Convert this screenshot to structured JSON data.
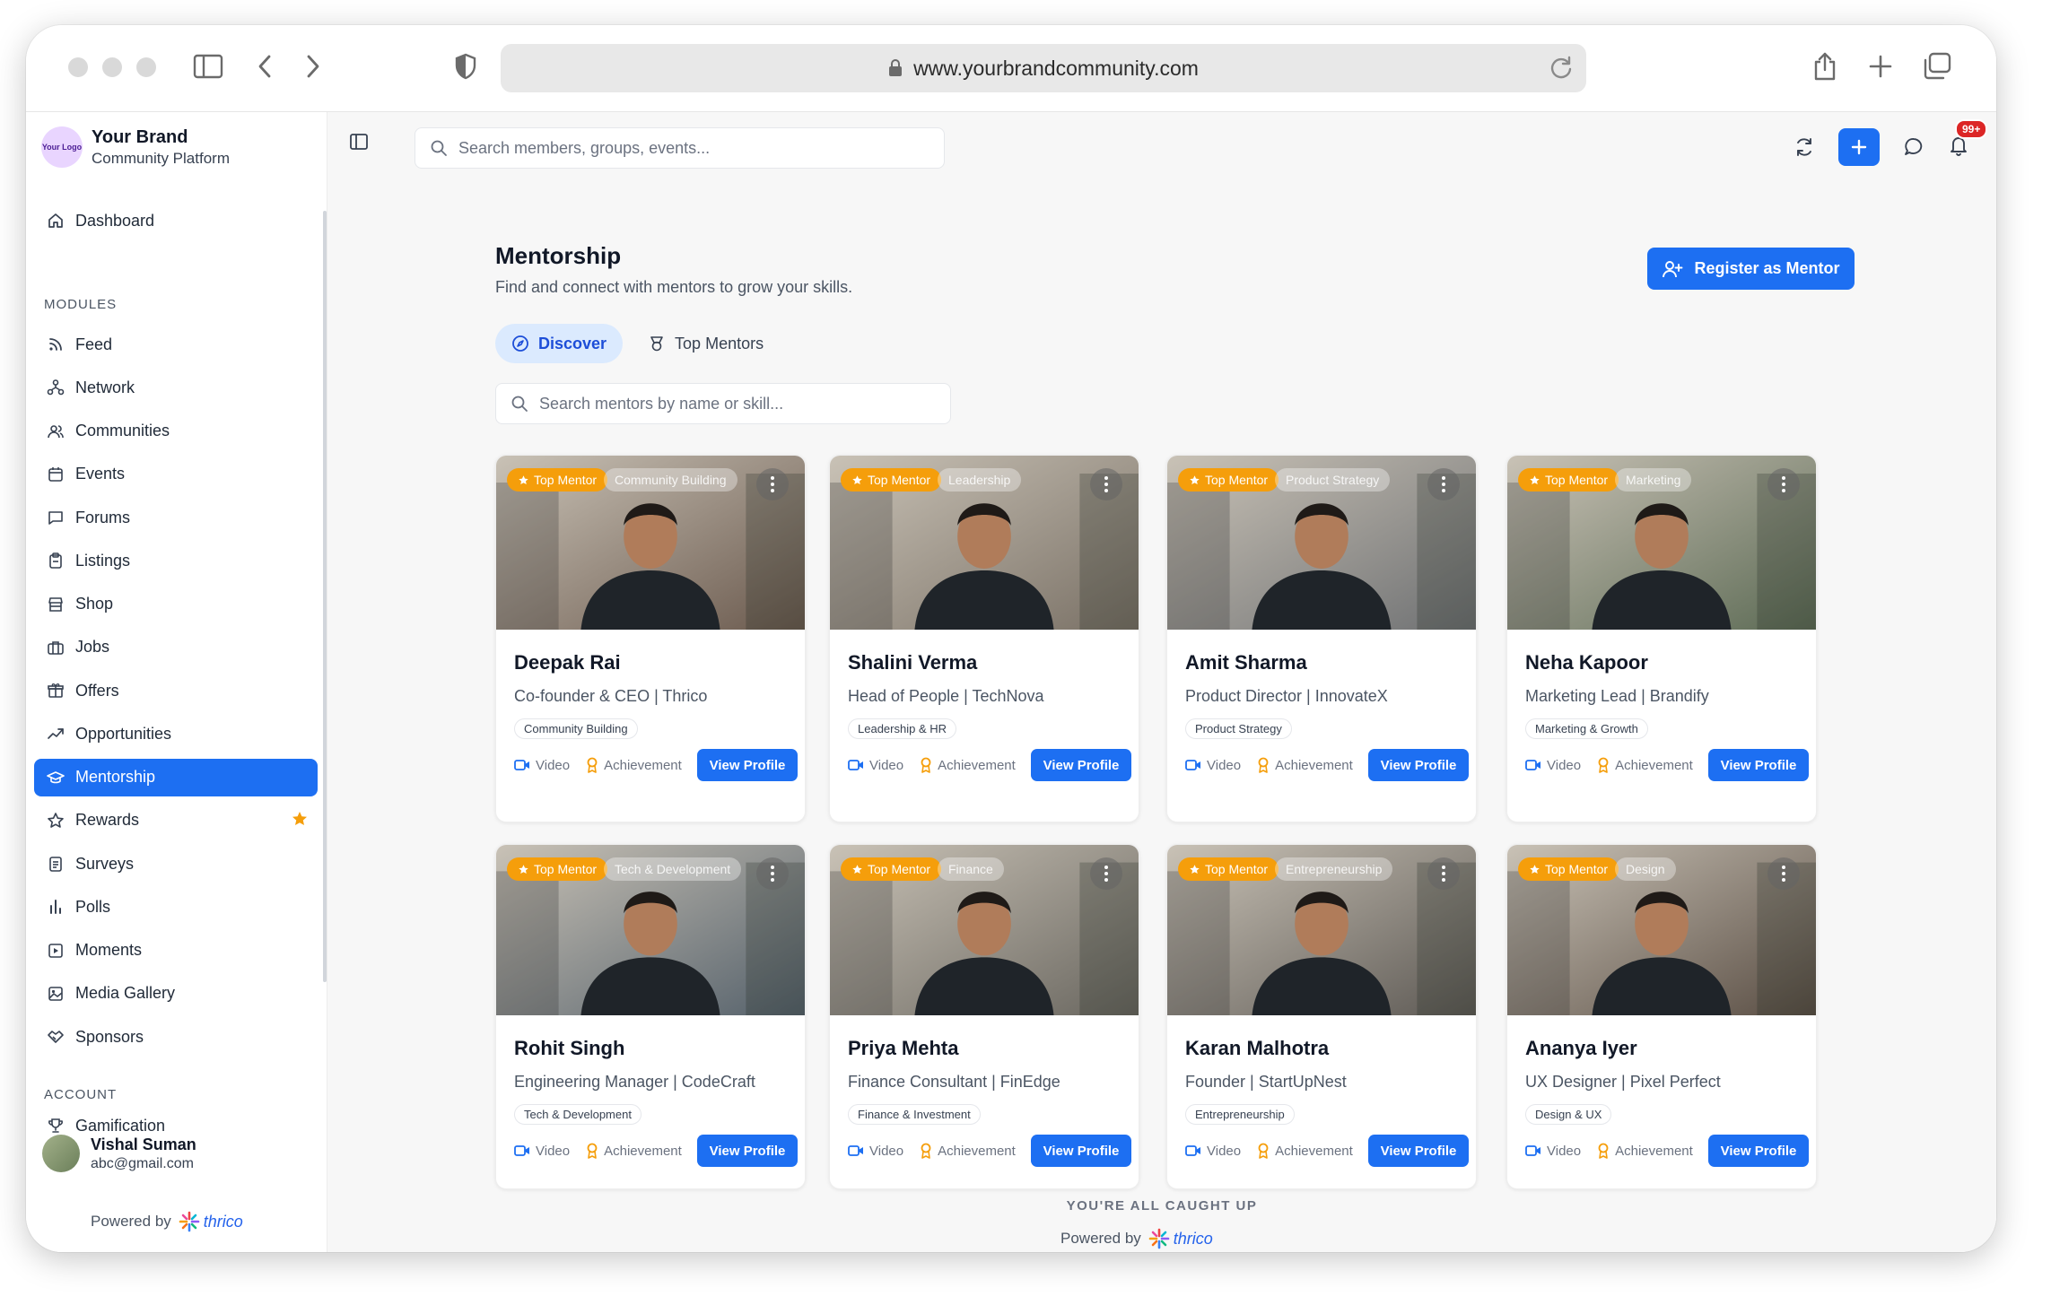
{
  "browser": {
    "url": "www.yourbrandcommunity.com"
  },
  "brand": {
    "logo_text": "Your Logo",
    "name": "Your Brand",
    "subtitle": "Community Platform"
  },
  "sidebar": {
    "top_item": {
      "label": "Dashboard",
      "icon": "home-icon"
    },
    "modules_heading": "MODULES",
    "modules": [
      {
        "label": "Feed",
        "icon": "rss-icon"
      },
      {
        "label": "Network",
        "icon": "network-icon"
      },
      {
        "label": "Communities",
        "icon": "users-icon"
      },
      {
        "label": "Events",
        "icon": "calendar-icon"
      },
      {
        "label": "Forums",
        "icon": "message-square-icon"
      },
      {
        "label": "Listings",
        "icon": "clipboard-icon"
      },
      {
        "label": "Shop",
        "icon": "store-icon"
      },
      {
        "label": "Jobs",
        "icon": "briefcase-icon"
      },
      {
        "label": "Offers",
        "icon": "gift-icon"
      },
      {
        "label": "Opportunities",
        "icon": "trending-up-icon"
      },
      {
        "label": "Mentorship",
        "icon": "graduation-cap-icon",
        "active": true
      },
      {
        "label": "Rewards",
        "icon": "star-icon"
      },
      {
        "label": "Surveys",
        "icon": "clipboard-list-icon"
      },
      {
        "label": "Polls",
        "icon": "bar-chart-icon"
      },
      {
        "label": "Moments",
        "icon": "play-square-icon"
      },
      {
        "label": "Media Gallery",
        "icon": "image-icon"
      },
      {
        "label": "Sponsors",
        "icon": "handshake-icon"
      }
    ],
    "account_heading": "ACCOUNT",
    "account": [
      {
        "label": "Gamification",
        "icon": "trophy-icon"
      }
    ],
    "user": {
      "name": "Vishal Suman",
      "email": "abc@gmail.com"
    },
    "powered_by": "Powered by",
    "powered_brand": "thrico"
  },
  "topbar": {
    "search_placeholder": "Search members, groups, events...",
    "notification_count": "99+"
  },
  "page": {
    "title": "Mentorship",
    "subtitle": "Find and connect with mentors to grow your skills.",
    "register_label": "Register as Mentor",
    "tabs": [
      {
        "label": "Discover",
        "active": true
      },
      {
        "label": "Top Mentors",
        "active": false
      }
    ],
    "search_placeholder": "Search mentors by name or skill...",
    "caught_up": "YOU'RE ALL CAUGHT UP",
    "powered_by": "Powered by",
    "powered_brand": "thrico"
  },
  "mentors": [
    {
      "badge": "Top Mentor",
      "category": "Community Building",
      "name": "Deepak Rai",
      "role": "Co-founder & CEO | Thrico",
      "skill": "Community Building",
      "video": "Video",
      "achievement": "Achievement",
      "action": "View Profile",
      "tone": "#6b5a4e"
    },
    {
      "badge": "Top Mentor",
      "category": "Leadership",
      "name": "Shalini Verma",
      "role": "Head of People | TechNova",
      "skill": "Leadership & HR",
      "video": "Video",
      "achievement": "Achievement",
      "action": "View Profile",
      "tone": "#7a7166"
    },
    {
      "badge": "Top Mentor",
      "category": "Product Strategy",
      "name": "Amit Sharma",
      "role": "Product Director | InnovateX",
      "skill": "Product Strategy",
      "video": "Video",
      "achievement": "Achievement",
      "action": "View Profile",
      "tone": "#6f7173"
    },
    {
      "badge": "Top Mentor",
      "category": "Marketing",
      "name": "Neha Kapoor",
      "role": "Marketing Lead | Brandify",
      "skill": "Marketing & Growth",
      "video": "Video",
      "achievement": "Achievement",
      "action": "View Profile",
      "tone": "#5d6b55"
    },
    {
      "badge": "Top Mentor",
      "category": "Tech & Development",
      "name": "Rohit Singh",
      "role": "Engineering Manager | CodeCraft",
      "skill": "Tech & Development",
      "video": "Video",
      "achievement": "Achievement",
      "action": "View Profile",
      "tone": "#55616b"
    },
    {
      "badge": "Top Mentor",
      "category": "Finance",
      "name": "Priya Mehta",
      "role": "Finance Consultant | FinEdge",
      "skill": "Finance & Investment",
      "video": "Video",
      "achievement": "Achievement",
      "action": "View Profile",
      "tone": "#6a6760"
    },
    {
      "badge": "Top Mentor",
      "category": "Entrepreneurship",
      "name": "Karan Malhotra",
      "role": "Founder | StartUpNest",
      "skill": "Entrepreneurship",
      "video": "Video",
      "achievement": "Achievement",
      "action": "View Profile",
      "tone": "#5e5a55"
    },
    {
      "badge": "Top Mentor",
      "category": "Design",
      "name": "Ananya Iyer",
      "role": "UX Designer | Pixel Perfect",
      "skill": "Design & UX",
      "video": "Video",
      "achievement": "Achievement",
      "action": "View Profile",
      "tone": "#5a4e44"
    }
  ]
}
